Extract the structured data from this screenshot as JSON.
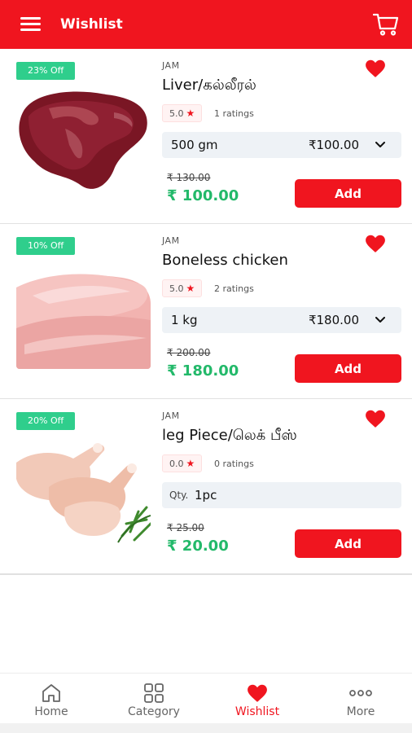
{
  "header": {
    "title": "Wishlist",
    "menu_icon": "hamburger-icon",
    "cart_icon": "cart-icon"
  },
  "accent_color": "#f0151f",
  "discount_color": "#2fce8c",
  "price_color": "#23b96a",
  "products": [
    {
      "discount": "23% Off",
      "brand": "JAM",
      "name": "Liver/கல்லீரல்",
      "rating": "5.0",
      "rating_count": "1 ratings",
      "variant_qty": "500 gm",
      "variant_price": "₹100.00",
      "old_price": "₹ 130.00",
      "new_price": "₹ 100.00",
      "add_label": "Add",
      "wishlisted": true
    },
    {
      "discount": "10% Off",
      "brand": "JAM",
      "name": "Boneless chicken",
      "rating": "5.0",
      "rating_count": "2 ratings",
      "variant_qty": "1 kg",
      "variant_price": "₹180.00",
      "old_price": "₹ 200.00",
      "new_price": "₹ 180.00",
      "add_label": "Add",
      "wishlisted": true
    },
    {
      "discount": "20% Off",
      "brand": "JAM",
      "name": "leg Piece/லெக் பீஸ்",
      "rating": "0.0",
      "rating_count": "0 ratings",
      "qty_label": "Qty.",
      "qty_value": "1pc",
      "old_price": "₹ 25.00",
      "new_price": "₹ 20.00",
      "add_label": "Add",
      "wishlisted": true
    }
  ],
  "nav": [
    {
      "label": "Home",
      "icon": "home-icon"
    },
    {
      "label": "Category",
      "icon": "category-grid-icon"
    },
    {
      "label": "Wishlist",
      "icon": "heart-icon",
      "active": true
    },
    {
      "label": "More",
      "icon": "more-dots-icon"
    }
  ]
}
